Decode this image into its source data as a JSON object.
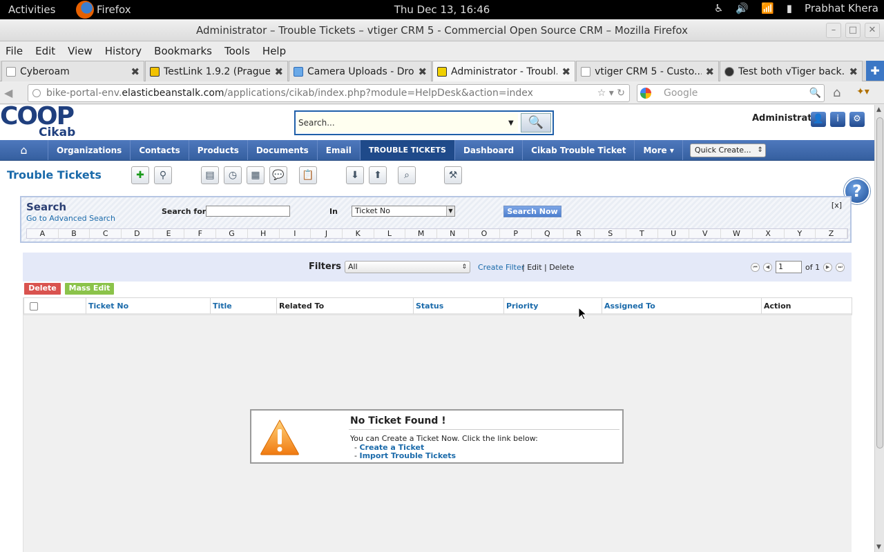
{
  "system": {
    "activities": "Activities",
    "app": "Firefox",
    "clock": "Thu Dec 13, 16:46",
    "user": "Prabhat Khera"
  },
  "window": {
    "title": "Administrator – Trouble Tickets – vtiger CRM 5 - Commercial Open Source CRM – Mozilla Firefox"
  },
  "menubar": [
    "File",
    "Edit",
    "View",
    "History",
    "Bookmarks",
    "Tools",
    "Help"
  ],
  "tabs": [
    {
      "label": "Cyberoam",
      "active": false
    },
    {
      "label": "TestLink 1.9.2 (Prague)",
      "active": false
    },
    {
      "label": "Camera Uploads - Dro...",
      "active": false
    },
    {
      "label": "Administrator - Troubl...",
      "active": true
    },
    {
      "label": "vtiger CRM 5 - Custo...",
      "active": false
    },
    {
      "label": "Test both vTiger back...",
      "active": false
    }
  ],
  "newtab_icon": "plus-icon",
  "url": {
    "prefix": "bike-portal-env.",
    "domain": "elasticbeanstalk.com",
    "path": "/applications/cikab/index.php?module=HelpDesk&action=index"
  },
  "search_engine": {
    "placeholder": "Google"
  },
  "crm": {
    "logo_top": "COOP",
    "logo_bottom": "Cikab",
    "global_search_placeholder": "Search...",
    "user": "Administrator",
    "nav": [
      "Organizations",
      "Contacts",
      "Products",
      "Documents",
      "Email",
      "TROUBLE TICKETS",
      "Dashboard",
      "Cikab Trouble Ticket",
      "More"
    ],
    "quick_create": "Quick Create...",
    "page_title": "Trouble Tickets",
    "search": {
      "title": "Search",
      "advanced_link": "Go to Advanced Search",
      "search_for_label": "Search for",
      "in_label": "In",
      "in_value": "Ticket No",
      "button": "Search Now",
      "close": "[x]",
      "letters": [
        "A",
        "B",
        "C",
        "D",
        "E",
        "F",
        "G",
        "H",
        "I",
        "J",
        "K",
        "L",
        "M",
        "N",
        "O",
        "P",
        "Q",
        "R",
        "S",
        "T",
        "U",
        "V",
        "W",
        "X",
        "Y",
        "Z"
      ]
    },
    "filters": {
      "label": "Filters :",
      "value": "All",
      "create": "Create Filter",
      "edit_delete": "| Edit | Delete",
      "page": "1",
      "of": "of 1"
    },
    "actions": {
      "delete": "Delete",
      "mass_edit": "Mass Edit"
    },
    "columns": [
      "Ticket No",
      "Title",
      "Related To",
      "Status",
      "Priority",
      "Assigned To",
      "Action"
    ],
    "empty": {
      "title": "No Ticket Found !",
      "desc": "You can Create a Ticket Now. Click the link below:",
      "link1": "Create a Ticket",
      "link2": "Import Trouble Tickets",
      "bullet": "-"
    }
  },
  "colors": {
    "nav_blue": "#355f9f",
    "link": "#1a6aaa",
    "delete_btn": "#d9534f",
    "mass_edit_btn": "#8bc34a"
  }
}
